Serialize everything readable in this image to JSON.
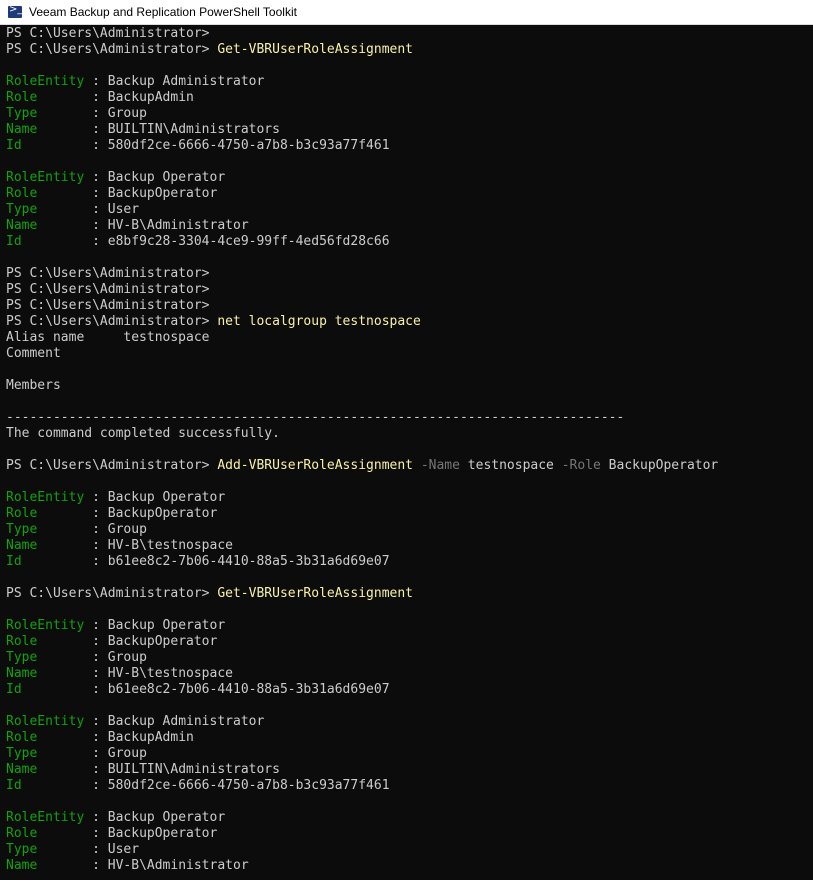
{
  "window": {
    "title": "Veeam Backup and Replication PowerShell Toolkit",
    "icon": "powershell-icon"
  },
  "colors": {
    "background": "#0c0c0c",
    "text": "#cccccc",
    "command": "#f9f1a5",
    "parameter": "#767676",
    "property_label": "#13a10e"
  },
  "console": {
    "lines": [
      [
        {
          "t": "PS C:\\Users\\Administrator>",
          "c": "text"
        }
      ],
      [
        {
          "t": "PS C:\\Users\\Administrator> ",
          "c": "text"
        },
        {
          "t": "Get-VBRUserRoleAssignment",
          "c": "cmd"
        }
      ],
      [],
      [
        {
          "t": "RoleEntity",
          "c": "label"
        },
        {
          "t": " : Backup Administrator",
          "c": "text"
        }
      ],
      [
        {
          "t": "Role      ",
          "c": "label"
        },
        {
          "t": " : BackupAdmin",
          "c": "text"
        }
      ],
      [
        {
          "t": "Type      ",
          "c": "label"
        },
        {
          "t": " : Group",
          "c": "text"
        }
      ],
      [
        {
          "t": "Name      ",
          "c": "label"
        },
        {
          "t": " : BUILTIN\\Administrators",
          "c": "text"
        }
      ],
      [
        {
          "t": "Id        ",
          "c": "label"
        },
        {
          "t": " : 580df2ce-6666-4750-a7b8-b3c93a77f461",
          "c": "text"
        }
      ],
      [],
      [
        {
          "t": "RoleEntity",
          "c": "label"
        },
        {
          "t": " : Backup Operator",
          "c": "text"
        }
      ],
      [
        {
          "t": "Role      ",
          "c": "label"
        },
        {
          "t": " : BackupOperator",
          "c": "text"
        }
      ],
      [
        {
          "t": "Type      ",
          "c": "label"
        },
        {
          "t": " : User",
          "c": "text"
        }
      ],
      [
        {
          "t": "Name      ",
          "c": "label"
        },
        {
          "t": " : HV-B\\Administrator",
          "c": "text"
        }
      ],
      [
        {
          "t": "Id        ",
          "c": "label"
        },
        {
          "t": " : e8bf9c28-3304-4ce9-99ff-4ed56fd28c66",
          "c": "text"
        }
      ],
      [],
      [
        {
          "t": "PS C:\\Users\\Administrator>",
          "c": "text"
        }
      ],
      [
        {
          "t": "PS C:\\Users\\Administrator>",
          "c": "text"
        }
      ],
      [
        {
          "t": "PS C:\\Users\\Administrator>",
          "c": "text"
        }
      ],
      [
        {
          "t": "PS C:\\Users\\Administrator> ",
          "c": "text"
        },
        {
          "t": "net localgroup testnospace",
          "c": "cmd"
        }
      ],
      [
        {
          "t": "Alias name     testnospace",
          "c": "text"
        }
      ],
      [
        {
          "t": "Comment",
          "c": "text"
        }
      ],
      [],
      [
        {
          "t": "Members",
          "c": "text"
        }
      ],
      [],
      [
        {
          "t": "-------------------------------------------------------------------------------",
          "c": "text"
        }
      ],
      [
        {
          "t": "The command completed successfully.",
          "c": "text"
        }
      ],
      [],
      [
        {
          "t": "PS C:\\Users\\Administrator> ",
          "c": "text"
        },
        {
          "t": "Add-VBRUserRoleAssignment",
          "c": "cmd"
        },
        {
          "t": " -Name",
          "c": "param"
        },
        {
          "t": " testnospace",
          "c": "text"
        },
        {
          "t": " -Role",
          "c": "param"
        },
        {
          "t": " BackupOperator",
          "c": "text"
        }
      ],
      [],
      [
        {
          "t": "RoleEntity",
          "c": "label"
        },
        {
          "t": " : Backup Operator",
          "c": "text"
        }
      ],
      [
        {
          "t": "Role      ",
          "c": "label"
        },
        {
          "t": " : BackupOperator",
          "c": "text"
        }
      ],
      [
        {
          "t": "Type      ",
          "c": "label"
        },
        {
          "t": " : Group",
          "c": "text"
        }
      ],
      [
        {
          "t": "Name      ",
          "c": "label"
        },
        {
          "t": " : HV-B\\testnospace",
          "c": "text"
        }
      ],
      [
        {
          "t": "Id        ",
          "c": "label"
        },
        {
          "t": " : b61ee8c2-7b06-4410-88a5-3b31a6d69e07",
          "c": "text"
        }
      ],
      [],
      [
        {
          "t": "PS C:\\Users\\Administrator> ",
          "c": "text"
        },
        {
          "t": "Get-VBRUserRoleAssignment",
          "c": "cmd"
        }
      ],
      [],
      [
        {
          "t": "RoleEntity",
          "c": "label"
        },
        {
          "t": " : Backup Operator",
          "c": "text"
        }
      ],
      [
        {
          "t": "Role      ",
          "c": "label"
        },
        {
          "t": " : BackupOperator",
          "c": "text"
        }
      ],
      [
        {
          "t": "Type      ",
          "c": "label"
        },
        {
          "t": " : Group",
          "c": "text"
        }
      ],
      [
        {
          "t": "Name      ",
          "c": "label"
        },
        {
          "t": " : HV-B\\testnospace",
          "c": "text"
        }
      ],
      [
        {
          "t": "Id        ",
          "c": "label"
        },
        {
          "t": " : b61ee8c2-7b06-4410-88a5-3b31a6d69e07",
          "c": "text"
        }
      ],
      [],
      [
        {
          "t": "RoleEntity",
          "c": "label"
        },
        {
          "t": " : Backup Administrator",
          "c": "text"
        }
      ],
      [
        {
          "t": "Role      ",
          "c": "label"
        },
        {
          "t": " : BackupAdmin",
          "c": "text"
        }
      ],
      [
        {
          "t": "Type      ",
          "c": "label"
        },
        {
          "t": " : Group",
          "c": "text"
        }
      ],
      [
        {
          "t": "Name      ",
          "c": "label"
        },
        {
          "t": " : BUILTIN\\Administrators",
          "c": "text"
        }
      ],
      [
        {
          "t": "Id        ",
          "c": "label"
        },
        {
          "t": " : 580df2ce-6666-4750-a7b8-b3c93a77f461",
          "c": "text"
        }
      ],
      [],
      [
        {
          "t": "RoleEntity",
          "c": "label"
        },
        {
          "t": " : Backup Operator",
          "c": "text"
        }
      ],
      [
        {
          "t": "Role      ",
          "c": "label"
        },
        {
          "t": " : BackupOperator",
          "c": "text"
        }
      ],
      [
        {
          "t": "Type      ",
          "c": "label"
        },
        {
          "t": " : User",
          "c": "text"
        }
      ],
      [
        {
          "t": "Name      ",
          "c": "label"
        },
        {
          "t": " : HV-B\\Administrator",
          "c": "text"
        }
      ]
    ]
  }
}
